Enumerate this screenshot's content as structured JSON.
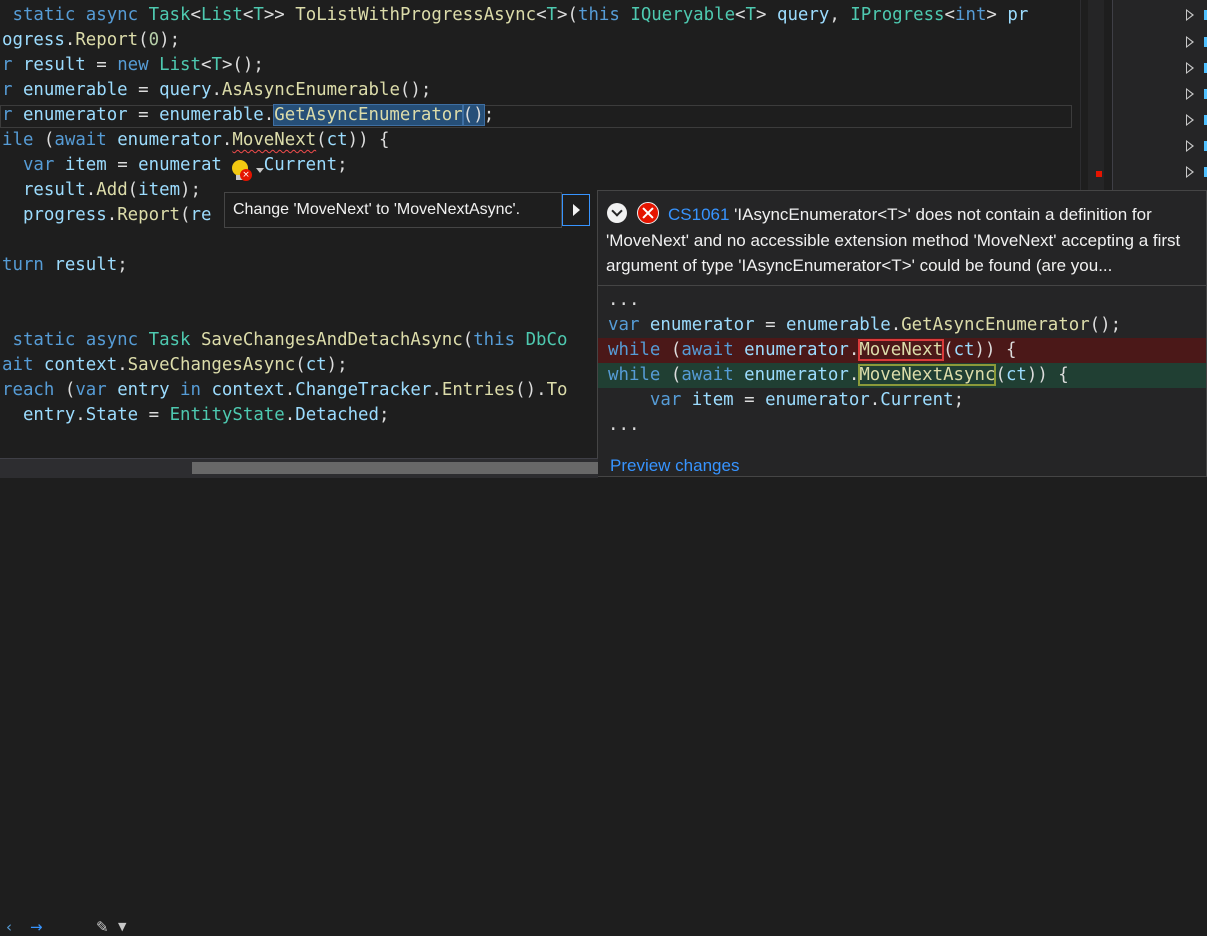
{
  "editor": {
    "lines": [
      {
        "tokens": [
          {
            "t": " static async ",
            "c": "kw"
          },
          {
            "t": "Task",
            "c": "ty"
          },
          {
            "t": "<",
            "c": "pl"
          },
          {
            "t": "List",
            "c": "ty"
          },
          {
            "t": "<",
            "c": "pl"
          },
          {
            "t": "T",
            "c": "ty"
          },
          {
            "t": ">> ",
            "c": "pl"
          },
          {
            "t": "ToListWithProgressAsync",
            "c": "fn"
          },
          {
            "t": "<",
            "c": "pl"
          },
          {
            "t": "T",
            "c": "ty"
          },
          {
            "t": ">(",
            "c": "pl"
          },
          {
            "t": "this ",
            "c": "kw"
          },
          {
            "t": "IQueryable",
            "c": "ty"
          },
          {
            "t": "<",
            "c": "pl"
          },
          {
            "t": "T",
            "c": "ty"
          },
          {
            "t": "> ",
            "c": "pl"
          },
          {
            "t": "query",
            "c": "id"
          },
          {
            "t": ", ",
            "c": "pl"
          },
          {
            "t": "IProgress",
            "c": "ty"
          },
          {
            "t": "<",
            "c": "pl"
          },
          {
            "t": "int",
            "c": "kw"
          },
          {
            "t": "> ",
            "c": "pl"
          },
          {
            "t": "pr",
            "c": "id"
          }
        ]
      },
      {
        "tokens": [
          {
            "t": "ogress",
            "c": "id"
          },
          {
            "t": ".",
            "c": "pl"
          },
          {
            "t": "Report",
            "c": "fn"
          },
          {
            "t": "(",
            "c": "pl"
          },
          {
            "t": "0",
            "c": "nm"
          },
          {
            "t": ");",
            "c": "pl"
          }
        ]
      },
      {
        "tokens": [
          {
            "t": "r ",
            "c": "kw"
          },
          {
            "t": "result",
            "c": "id"
          },
          {
            "t": " = ",
            "c": "pl"
          },
          {
            "t": "new ",
            "c": "kw"
          },
          {
            "t": "List",
            "c": "ty"
          },
          {
            "t": "<",
            "c": "pl"
          },
          {
            "t": "T",
            "c": "ty"
          },
          {
            "t": ">();",
            "c": "pl"
          }
        ]
      },
      {
        "tokens": [
          {
            "t": "r ",
            "c": "kw"
          },
          {
            "t": "enumerable",
            "c": "id"
          },
          {
            "t": " = ",
            "c": "pl"
          },
          {
            "t": "query",
            "c": "id"
          },
          {
            "t": ".",
            "c": "pl"
          },
          {
            "t": "AsAsyncEnumerable",
            "c": "fn"
          },
          {
            "t": "();",
            "c": "pl"
          }
        ]
      },
      {
        "tokens": [
          {
            "t": "r ",
            "c": "kw"
          },
          {
            "t": "enumerator",
            "c": "id"
          },
          {
            "t": " = ",
            "c": "pl"
          },
          {
            "t": "enumerable",
            "c": "id"
          },
          {
            "t": ".",
            "c": "pl"
          },
          {
            "t": "GetAsyncEnumerator",
            "c": "fn sel"
          },
          {
            "t": "()",
            "c": "pl sel"
          },
          {
            "t": ";",
            "c": "pl"
          }
        ]
      },
      {
        "tokens": [
          {
            "t": "ile ",
            "c": "kw"
          },
          {
            "t": "(",
            "c": "pl"
          },
          {
            "t": "await ",
            "c": "kw"
          },
          {
            "t": "enumerator",
            "c": "id"
          },
          {
            "t": ".",
            "c": "pl"
          },
          {
            "t": "MoveNext",
            "c": "fn squig"
          },
          {
            "t": "(",
            "c": "pl"
          },
          {
            "t": "ct",
            "c": "id"
          },
          {
            "t": ")) {",
            "c": "pl"
          }
        ]
      },
      {
        "tokens": [
          {
            "t": "  var ",
            "c": "kw"
          },
          {
            "t": "item",
            "c": "id"
          },
          {
            "t": " = ",
            "c": "pl"
          },
          {
            "t": "enumerat",
            "c": "id"
          },
          {
            "t": "    ",
            "c": "pl"
          },
          {
            "t": "Current",
            "c": "id"
          },
          {
            "t": ";",
            "c": "pl"
          }
        ]
      },
      {
        "tokens": [
          {
            "t": "  result",
            "c": "id"
          },
          {
            "t": ".",
            "c": "pl"
          },
          {
            "t": "Add",
            "c": "fn"
          },
          {
            "t": "(",
            "c": "pl"
          },
          {
            "t": "item",
            "c": "id"
          },
          {
            "t": ");",
            "c": "pl"
          }
        ]
      },
      {
        "tokens": [
          {
            "t": "  progress",
            "c": "id"
          },
          {
            "t": ".",
            "c": "pl"
          },
          {
            "t": "Report",
            "c": "fn"
          },
          {
            "t": "(",
            "c": "pl"
          },
          {
            "t": "re",
            "c": "id"
          }
        ]
      },
      {
        "tokens": []
      },
      {
        "tokens": [
          {
            "t": "turn ",
            "c": "kw"
          },
          {
            "t": "result",
            "c": "id"
          },
          {
            "t": ";",
            "c": "pl"
          }
        ]
      },
      {
        "tokens": []
      },
      {
        "tokens": []
      },
      {
        "tokens": [
          {
            "t": " static async ",
            "c": "kw"
          },
          {
            "t": "Task ",
            "c": "ty"
          },
          {
            "t": "SaveChangesAndDetachAsync",
            "c": "fn"
          },
          {
            "t": "(",
            "c": "pl"
          },
          {
            "t": "this ",
            "c": "kw"
          },
          {
            "t": "DbCo",
            "c": "ty"
          }
        ]
      },
      {
        "tokens": [
          {
            "t": "ait ",
            "c": "kw"
          },
          {
            "t": "context",
            "c": "id"
          },
          {
            "t": ".",
            "c": "pl"
          },
          {
            "t": "SaveChangesAsync",
            "c": "fn"
          },
          {
            "t": "(",
            "c": "pl"
          },
          {
            "t": "ct",
            "c": "id"
          },
          {
            "t": ");",
            "c": "pl"
          }
        ]
      },
      {
        "tokens": [
          {
            "t": "reach ",
            "c": "kw"
          },
          {
            "t": "(",
            "c": "pl"
          },
          {
            "t": "var ",
            "c": "kw"
          },
          {
            "t": "entry ",
            "c": "id"
          },
          {
            "t": "in ",
            "c": "kw"
          },
          {
            "t": "context",
            "c": "id"
          },
          {
            "t": ".",
            "c": "pl"
          },
          {
            "t": "ChangeTracker",
            "c": "id"
          },
          {
            "t": ".",
            "c": "pl"
          },
          {
            "t": "Entries",
            "c": "fn"
          },
          {
            "t": "().",
            "c": "pl"
          },
          {
            "t": "To",
            "c": "fn"
          }
        ]
      },
      {
        "tokens": [
          {
            "t": "  entry",
            "c": "id"
          },
          {
            "t": ".",
            "c": "pl"
          },
          {
            "t": "State",
            "c": "id"
          },
          {
            "t": " = ",
            "c": "pl"
          },
          {
            "t": "EntityState",
            "c": "ty"
          },
          {
            "t": ".",
            "c": "pl"
          },
          {
            "t": "Detached",
            "c": "id"
          },
          {
            "t": ";",
            "c": "pl"
          }
        ]
      }
    ]
  },
  "quick_action": {
    "label": "Change 'MoveNext' to 'MoveNextAsync'.",
    "lightbulb_icon": "lightbulb-error-icon"
  },
  "diagnostic": {
    "code": "CS1061",
    "message": "'IAsyncEnumerator<T>' does not contain a definition for 'MoveNext' and no accessible extension method 'MoveNext' accepting a first argument of type 'IAsyncEnumerator<T>' could be found (are you..."
  },
  "preview": {
    "lines": [
      {
        "kind": "ctx",
        "tokens": [
          {
            "t": "...",
            "c": "pl"
          }
        ]
      },
      {
        "kind": "ctx",
        "tokens": [
          {
            "t": "var ",
            "c": "kw"
          },
          {
            "t": "enumerator",
            "c": "id"
          },
          {
            "t": " = ",
            "c": "pl"
          },
          {
            "t": "enumerable",
            "c": "id"
          },
          {
            "t": ".",
            "c": "pl"
          },
          {
            "t": "GetAsyncEnumerator",
            "c": "fn"
          },
          {
            "t": "();",
            "c": "pl"
          }
        ]
      },
      {
        "kind": "del",
        "tokens": [
          {
            "t": "while ",
            "c": "kw"
          },
          {
            "t": "(",
            "c": "pl"
          },
          {
            "t": "await ",
            "c": "kw"
          },
          {
            "t": "enumerator",
            "c": "id"
          },
          {
            "t": ".",
            "c": "pl"
          },
          {
            "t": "MoveNext",
            "c": "fn box-del"
          },
          {
            "t": "(",
            "c": "pl"
          },
          {
            "t": "ct",
            "c": "id"
          },
          {
            "t": ")) {",
            "c": "pl"
          }
        ]
      },
      {
        "kind": "add",
        "tokens": [
          {
            "t": "while ",
            "c": "kw"
          },
          {
            "t": "(",
            "c": "pl"
          },
          {
            "t": "await ",
            "c": "kw"
          },
          {
            "t": "enumerator",
            "c": "id"
          },
          {
            "t": ".",
            "c": "pl"
          },
          {
            "t": "MoveNextAsync",
            "c": "fn box-add"
          },
          {
            "t": "(",
            "c": "pl"
          },
          {
            "t": "ct",
            "c": "id"
          },
          {
            "t": ")) {",
            "c": "pl"
          }
        ]
      },
      {
        "kind": "ctx",
        "tokens": [
          {
            "t": "    var ",
            "c": "kw"
          },
          {
            "t": "item",
            "c": "id"
          },
          {
            "t": " = ",
            "c": "pl"
          },
          {
            "t": "enumerator",
            "c": "id"
          },
          {
            "t": ".",
            "c": "pl"
          },
          {
            "t": "Current",
            "c": "id"
          },
          {
            "t": ";",
            "c": "pl"
          }
        ]
      },
      {
        "kind": "ctx",
        "tokens": [
          {
            "t": "...",
            "c": "pl"
          }
        ]
      }
    ],
    "link_label": "Preview changes"
  },
  "bottom_bar": {
    "back_icon": "arrow-left-icon",
    "forward_icon": "arrow-right-icon",
    "brush_icon": "paintbrush-icon"
  },
  "colors": {
    "background": "#1e1e1e",
    "keyword": "#569cd6",
    "type": "#4ec9b0",
    "method": "#dcdcaa",
    "identifier": "#9cdcfe",
    "error": "#e51400",
    "link": "#3794ff"
  }
}
